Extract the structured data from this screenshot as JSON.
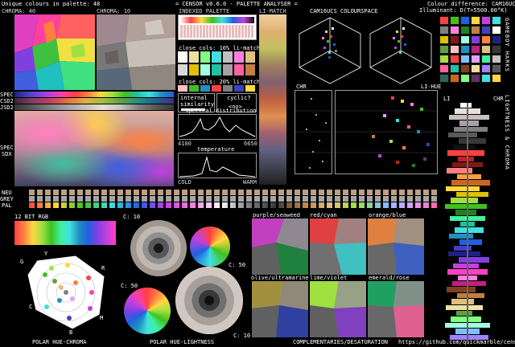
{
  "header": {
    "unique_colours": "Unique colours in palette: 48",
    "title": "= CENSOR v0.6.0 - PALETTE ANALYSER =",
    "colour_difference": "Colour difference: CAM16UCS",
    "illuminant": "Illuminant: D(T=5500.00°K)"
  },
  "top_panels": {
    "chroma40": "CHROMA: 40",
    "chroma10": "CHROMA: 10",
    "indexed_palette": "INDEXED PALETTE",
    "li_match": "LI-MATCH",
    "cam16ucs": "CAM16UCS COLOURSPACE"
  },
  "close_cols_1": "close cols: 10% li-match",
  "close_cols_2": "close cols: 20% li-match",
  "internal_similarity": "internal similarity",
  "cyclic_label": "cyclic?",
  "no_label": "<no>",
  "spectral_distribution": "spectral distribution",
  "spectral_min": "4100",
  "spectral_max": "6650",
  "temperature": "temperature",
  "cold": "COLD",
  "warm": "WARM",
  "side_labels": {
    "spec": "SPEC",
    "csd2": "CSD2",
    "jsd2": "JSD2",
    "spec2": "SPEC",
    "sdx": "SDX",
    "neu": "NEU",
    "grey": "GREY",
    "pal": "PAL"
  },
  "chr_label": "CHR",
  "li_hue_label": "LI-HUE",
  "li_label": "LI",
  "chr2_label": "CHR",
  "gameboy_sort": "GAMEBOY HARKS",
  "lightness_chroma": "LIGHTNESS & CHROMA",
  "bit_rgb": "12 BIT RGB",
  "c10_a": "C: 10",
  "c50_a": "C: 50",
  "c50_b": "C: 50",
  "c10_b": "C: 10",
  "polar_labels": {
    "g": "G",
    "y": "Y",
    "r": "R",
    "c": "C",
    "b": "B",
    "m": "M"
  },
  "comp_titles": [
    "purple/seaweed",
    "red/cyan",
    "orange/blue",
    "olive/ultramarine",
    "lime/violet",
    "emerald/rose"
  ],
  "footer": {
    "polar_hue_chroma": "POLAR HUE-CHROMA",
    "polar_hue_lightness": "POLAR HUE-LIGHTNESS",
    "complementaries": "COMPLEMENTARIES/DESATURATION",
    "url": "https://github.com/quickmarble/censor"
  },
  "colors": {
    "palette": [
      "#ffffff",
      "#e8e0d8",
      "#c8c0c0",
      "#a8a0a8",
      "#808080",
      "#585858",
      "#383838",
      "#101010",
      "#ff4040",
      "#c02020",
      "#801818",
      "#ff8080",
      "#ffa040",
      "#c86820",
      "#ffd840",
      "#e0c000",
      "#a0e040",
      "#40c020",
      "#208020",
      "#40f0a0",
      "#20c0a0",
      "#40e0e0",
      "#2090c0",
      "#2060e0",
      "#4040c0",
      "#202080",
      "#8040e0",
      "#c040e0",
      "#ff40c0",
      "#ff80e0",
      "#c02080",
      "#804020",
      "#c08040",
      "#e0c080",
      "#f0e0a0",
      "#60a040",
      "#80ff80",
      "#a0ffe0",
      "#80c0ff",
      "#a080ff",
      "#e0a0ff",
      "#ff60a0",
      "#ffc0c0",
      "#603060",
      "#306060",
      "#606030",
      "#a0a060",
      "#60a0a0"
    ]
  }
}
